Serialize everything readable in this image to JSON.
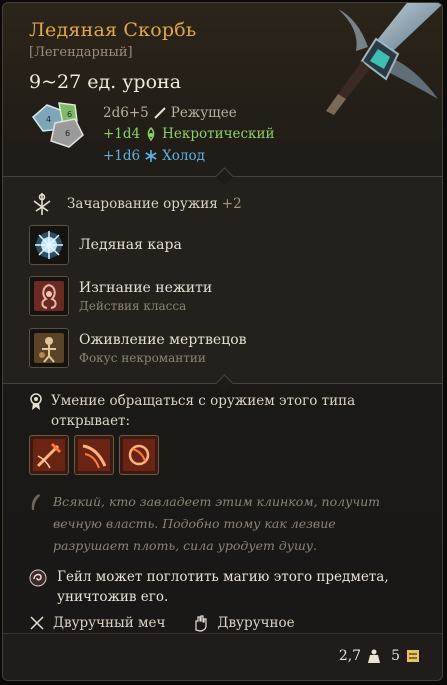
{
  "item": {
    "name": "Ледяная Скорбь",
    "rarity": "[Легендарный]",
    "damage_range": "9~27 ед. урона"
  },
  "damage_lines": [
    {
      "dice": "2d6+5",
      "type": "Режущее",
      "icon": "slashing-icon",
      "color": "#b9b0a0"
    },
    {
      "dice": "+1d4",
      "type": "Некротический",
      "icon": "necrotic-icon",
      "color": "#8fcf6a"
    },
    {
      "dice": "+1d6",
      "type": "Холод",
      "icon": "cold-icon",
      "color": "#5fb2e0"
    }
  ],
  "enchantment": {
    "label": "Зачарование оружия",
    "bonus": "+2"
  },
  "actions": [
    {
      "title": "Ледяная кара",
      "subtitle": ""
    },
    {
      "title": "Изгнание нежити",
      "subtitle": "Действия класса"
    },
    {
      "title": "Оживление мертвецов",
      "subtitle": "Фокус некромантии"
    }
  ],
  "proficiency": {
    "text": "Умение обращаться с оружием этого типа открывает:"
  },
  "lore": "Всякий, кто завладеет этим клинком, получит вечную власть. Подобно тому как лезвие разрушает плоть, сила уродует душу.",
  "gale_note": "Гейл может поглотить магию этого предмета, уничтожив его.",
  "tags": {
    "weapon_type": "Двуручный меч",
    "handedness": "Двуручное"
  },
  "footer": {
    "weight": "2,7",
    "value": "5"
  },
  "colors": {
    "name": "#e3a74b",
    "necrotic": "#8fcf6a",
    "cold": "#5fb2e0"
  }
}
